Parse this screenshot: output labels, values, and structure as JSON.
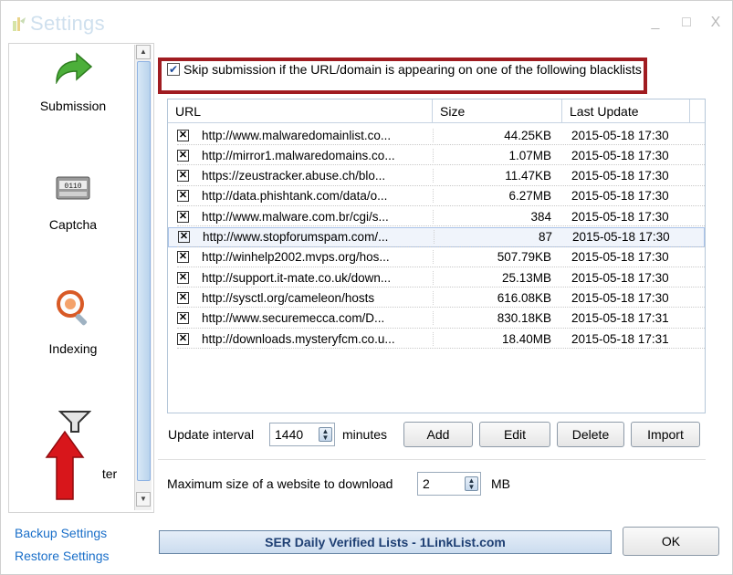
{
  "window": {
    "title": "Settings",
    "controls": [
      "_",
      "□",
      "X"
    ]
  },
  "sidebar": {
    "items": [
      {
        "label": "Submission",
        "icon": "green-arrow-icon"
      },
      {
        "label": "Captcha",
        "icon": "captcha-icon"
      },
      {
        "label": "Indexing",
        "icon": "indexing-icon"
      },
      {
        "label": "ter",
        "icon": "filter-icon"
      }
    ],
    "links": {
      "backup": "Backup Settings",
      "restore": "Restore Settings"
    }
  },
  "blacklist": {
    "skip_label": "Skip submission if the URL/domain is appearing on one of the following blacklists",
    "skip_checked": true,
    "columns": [
      "URL",
      "Size",
      "Last Update"
    ],
    "rows": [
      {
        "url": "http://www.malwaredomainlist.co...",
        "size": "44.25KB",
        "date": "2015-05-18 17:30"
      },
      {
        "url": "http://mirror1.malwaredomains.co...",
        "size": "1.07MB",
        "date": "2015-05-18 17:30"
      },
      {
        "url": "https://zeustracker.abuse.ch/blo...",
        "size": "11.47KB",
        "date": "2015-05-18 17:30"
      },
      {
        "url": "http://data.phishtank.com/data/o...",
        "size": "6.27MB",
        "date": "2015-05-18 17:30"
      },
      {
        "url": "http://www.malware.com.br/cgi/s...",
        "size": "384",
        "date": "2015-05-18 17:30"
      },
      {
        "url": "http://www.stopforumspam.com/...",
        "size": "87",
        "date": "2015-05-18 17:30"
      },
      {
        "url": "http://winhelp2002.mvps.org/hos...",
        "size": "507.79KB",
        "date": "2015-05-18 17:30"
      },
      {
        "url": "http://support.it-mate.co.uk/down...",
        "size": "25.13MB",
        "date": "2015-05-18 17:30"
      },
      {
        "url": "http://sysctl.org/cameleon/hosts",
        "size": "616.08KB",
        "date": "2015-05-18 17:30"
      },
      {
        "url": "http://www.securemecca.com/D...",
        "size": "830.18KB",
        "date": "2015-05-18 17:31"
      },
      {
        "url": "http://downloads.mysteryfcm.co.u...",
        "size": "18.40MB",
        "date": "2015-05-18 17:31"
      }
    ],
    "selected_row": 5
  },
  "controls": {
    "update_interval_label": "Update interval",
    "update_interval_value": "1440",
    "minutes_label": "minutes",
    "add": "Add",
    "edit": "Edit",
    "delete": "Delete",
    "import": "Import",
    "max_size_label": "Maximum size of a website to download",
    "max_size_value": "2",
    "mb_label": "MB"
  },
  "footer": {
    "status": "SER Daily Verified Lists - 1LinkList.com",
    "ok": "OK"
  },
  "colors": {
    "highlight_border": "#a01c21",
    "link": "#1a6fc9",
    "status_text": "#1e3f73",
    "arrow_red": "#d8161b"
  }
}
